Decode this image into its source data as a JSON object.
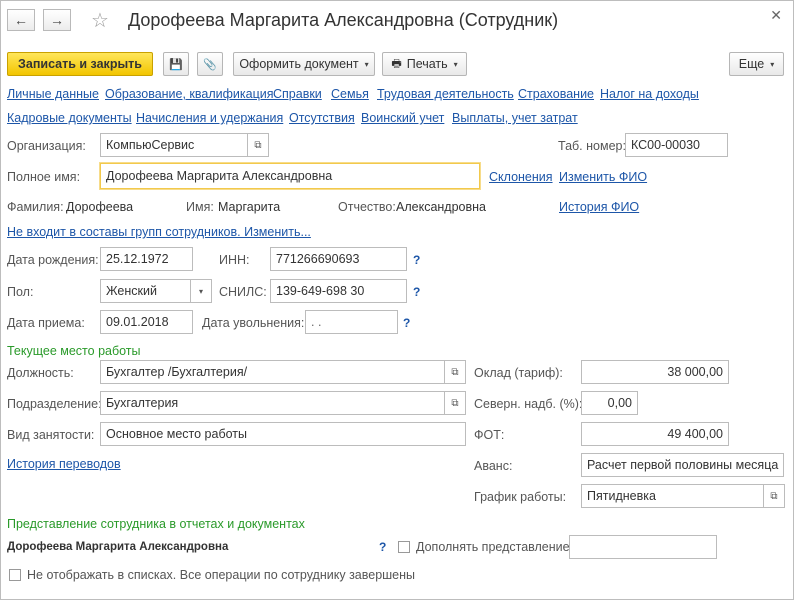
{
  "window": {
    "title": "Дорофеева Маргарита Александровна (Сотрудник)",
    "back_icon": "←",
    "forward_icon": "→",
    "star_icon": "☆",
    "close_icon": "✕"
  },
  "toolbar": {
    "save_close": "Записать и закрыть",
    "save_icon": "💾",
    "attach_icon": "📎",
    "create_doc": "Оформить документ",
    "print": "Печать",
    "more": "Еще",
    "caret": "▾"
  },
  "tabs_row1": [
    "Личные данные",
    "Образование, квалификация",
    "Справки",
    "Семья",
    "Трудовая деятельность",
    "Страхование",
    "Налог на доходы"
  ],
  "tabs_row2": [
    "Кадровые документы",
    "Начисления и удержания",
    "Отсутствия",
    "Воинский учет",
    "Выплаты, учет затрат"
  ],
  "form": {
    "org_label": "Организация:",
    "org_value": "КомпьюСервис",
    "tab_label": "Таб. номер:",
    "tab_value": "КС00-00030",
    "fullname_label": "Полное имя:",
    "fullname_value": "Дорофеева Маргарита Александровна",
    "declension_link": "Склонения",
    "change_fio_link": "Изменить ФИО",
    "surname_label": "Фамилия:",
    "surname_value": "Дорофеева",
    "name_label": "Имя:",
    "name_value": "Маргарита",
    "patronymic_label": "Отчество:",
    "patronymic_value": "Александровна",
    "fio_history_link": "История ФИО",
    "groups_link": "Не входит в составы групп сотрудников. Изменить...",
    "birth_label": "Дата рождения:",
    "birth_value": "25.12.1972",
    "inn_label": "ИНН:",
    "inn_value": "771266690693",
    "gender_label": "Пол:",
    "gender_value": "Женский",
    "snils_label": "СНИЛС:",
    "snils_value": "139-649-698 30",
    "hire_label": "Дата приема:",
    "hire_value": "09.01.2018",
    "fire_label": "Дата увольнения:",
    "fire_value": " .  .",
    "help_mark": "?"
  },
  "work": {
    "section_title": "Текущее место работы",
    "position_label": "Должность:",
    "position_value": "Бухгалтер /Бухгалтерия/",
    "dept_label": "Подразделение:",
    "dept_value": "Бухгалтерия",
    "employment_label": "Вид занятости:",
    "employment_value": "Основное место работы",
    "transfers_link": "История переводов",
    "salary_label": "Оклад (тариф):",
    "salary_value": "38 000,00",
    "north_label": "Северн. надб. (%):",
    "north_value": "0,00",
    "fot_label": "ФОТ:",
    "fot_value": "49 400,00",
    "advance_label": "Аванс:",
    "advance_value": "Расчет первой половины месяца",
    "schedule_label": "График работы:",
    "schedule_value": "Пятидневка",
    "open_icon": "⧉"
  },
  "representation": {
    "section_title": "Представление сотрудника в отчетах и документах",
    "name": "Дорофеева Маргарита Александровна",
    "supplement_label": "Дополнять представление",
    "supplement_value": "",
    "hide_label": "Не отображать в списках. Все операции по сотруднику завершены"
  }
}
